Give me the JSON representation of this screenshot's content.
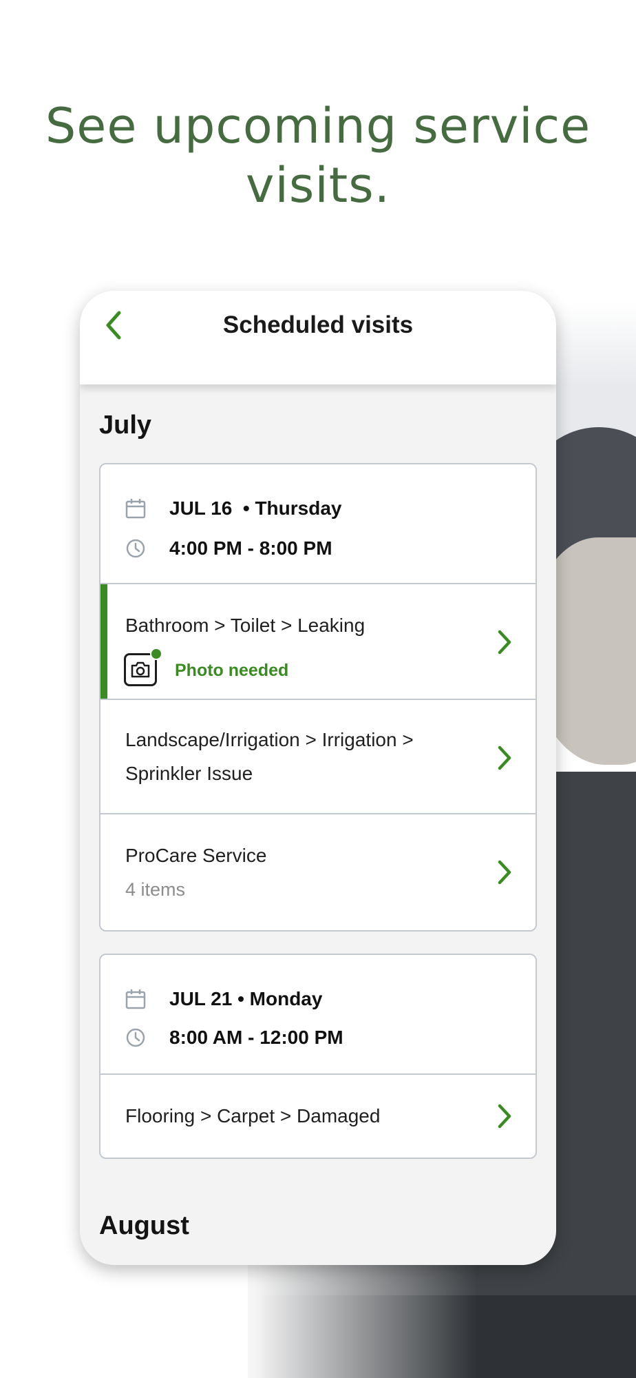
{
  "headline": "See upcoming service visits.",
  "header": {
    "title": "Scheduled visits",
    "back_icon": "chevron-left-icon"
  },
  "colors": {
    "brand_green": "#3b8a24",
    "headline_green": "#466b40"
  },
  "months": [
    {
      "label": "July",
      "visits": [
        {
          "date": "JUL 16  • Thursday",
          "time": "4:00 PM - 8:00 PM",
          "items": [
            {
              "title": "Bathroom > Toilet > Leaking",
              "badge": "Photo needed"
            },
            {
              "title": "Landscape/Irrigation > Irrigation >",
              "title_line2": "Sprinkler Issue"
            },
            {
              "title": "ProCare Service",
              "subtitle": "4 items"
            }
          ]
        },
        {
          "date": "JUL 21 • Monday",
          "time": "8:00 AM - 12:00 PM",
          "items": [
            {
              "title": "Flooring > Carpet > Damaged"
            }
          ]
        }
      ]
    },
    {
      "label": "August",
      "visits": []
    }
  ]
}
